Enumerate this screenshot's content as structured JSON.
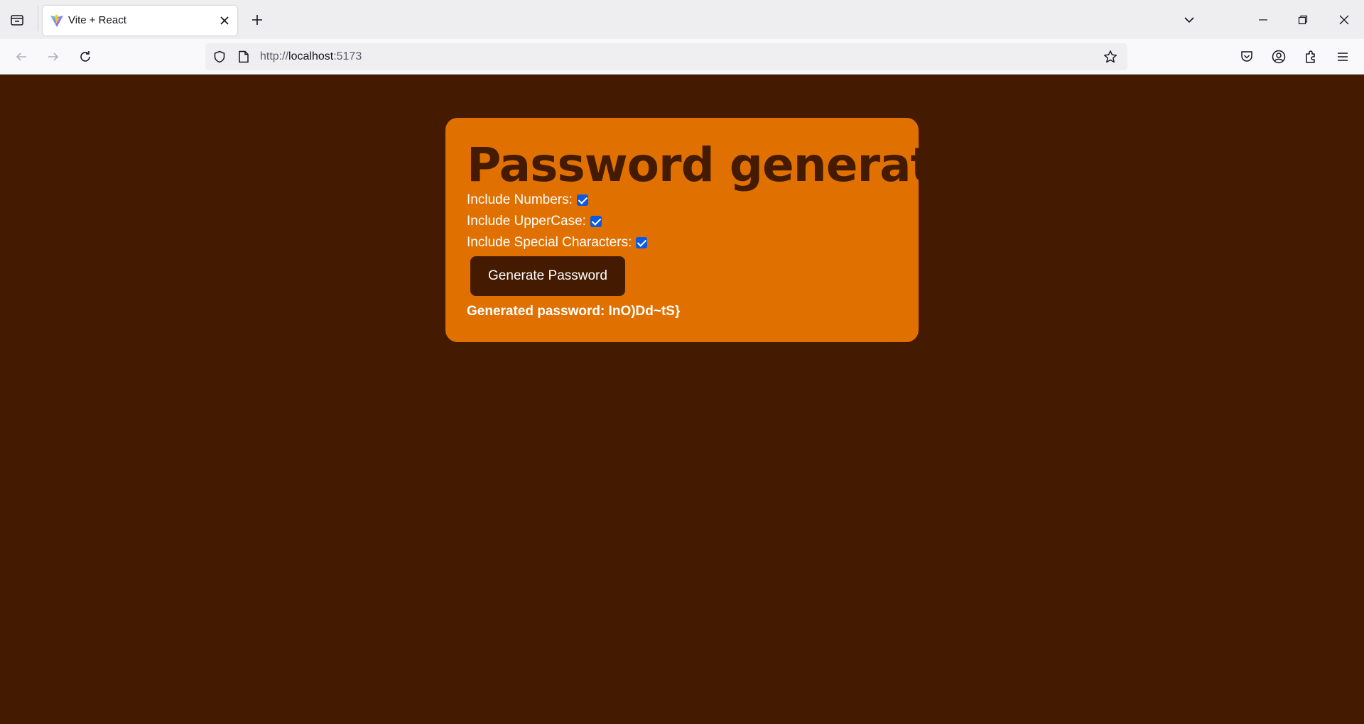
{
  "browser": {
    "tab": {
      "title": "Vite + React",
      "favicon": "vite-icon"
    },
    "url": {
      "scheme": "http://",
      "host": "localhost",
      "port": ":5173"
    },
    "toolbar_icons": [
      "back-icon",
      "forward-icon",
      "reload-icon",
      "shield-icon",
      "page-icon",
      "bookmark-star-icon",
      "pocket-icon",
      "account-icon",
      "extensions-icon",
      "menu-icon"
    ],
    "window_icons": [
      "tab-list-icon",
      "minimize-icon",
      "restore-icon",
      "close-icon"
    ]
  },
  "page": {
    "title": "Password generator",
    "options": [
      {
        "label": "Include Numbers:",
        "checked": true
      },
      {
        "label": "Include UpperCase:",
        "checked": true
      },
      {
        "label": "Include Special Characters:",
        "checked": true
      }
    ],
    "generate_button_label": "Generate Password",
    "result_label": "Generated password: InO)Dd~tS}"
  },
  "colors": {
    "page_background": "#441a00",
    "card_background": "#e07100",
    "checkbox_accent": "#0b5ae3",
    "text_light": "#ffffff"
  }
}
